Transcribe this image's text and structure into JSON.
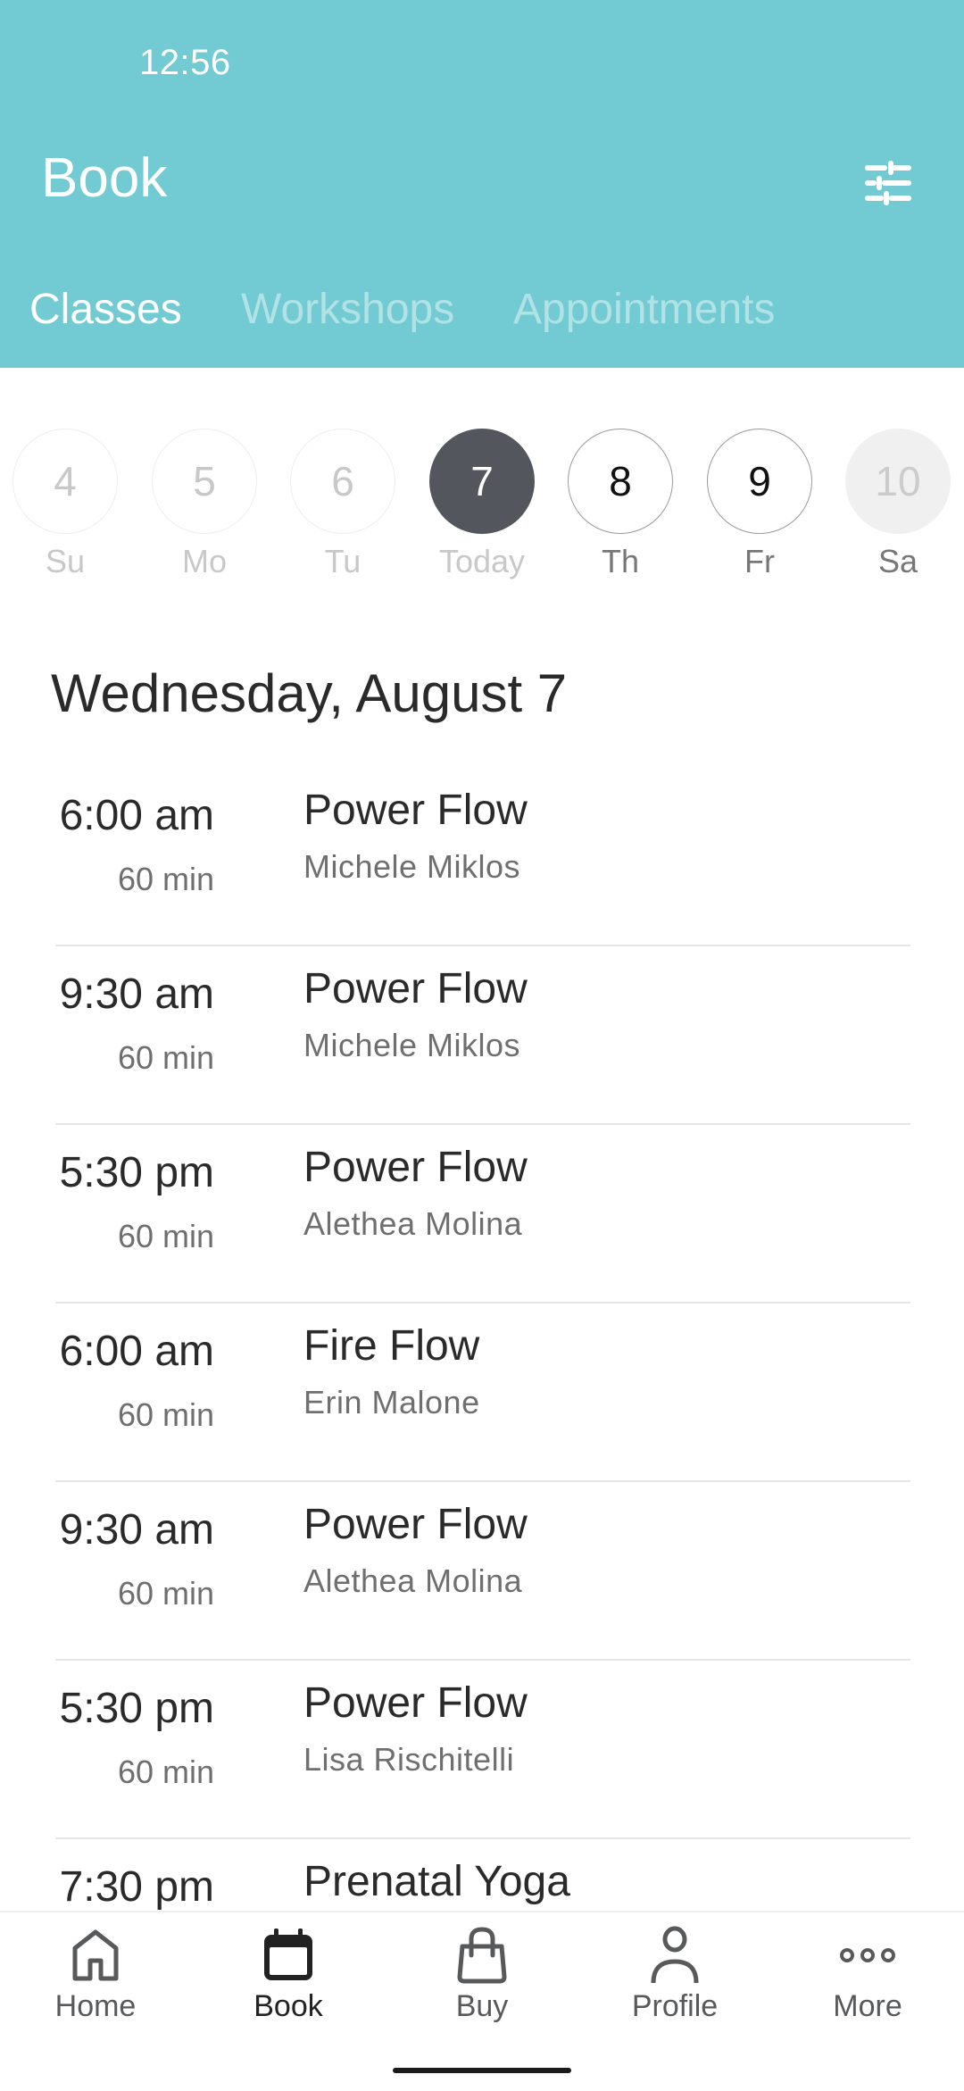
{
  "status_bar": {
    "time": "12:56"
  },
  "header": {
    "title": "Book",
    "filter_icon": "sliders-icon",
    "accent_color": "#72CBD2"
  },
  "tabs": [
    {
      "label": "Classes",
      "active": true
    },
    {
      "label": "Workshops",
      "active": false
    },
    {
      "label": "Appointments",
      "active": false
    }
  ],
  "days": [
    {
      "number": "4",
      "label": "Su",
      "state": "past"
    },
    {
      "number": "5",
      "label": "Mo",
      "state": "past"
    },
    {
      "number": "6",
      "label": "Tu",
      "state": "past"
    },
    {
      "number": "7",
      "label": "Today",
      "state": "selected"
    },
    {
      "number": "8",
      "label": "Th",
      "state": "future"
    },
    {
      "number": "9",
      "label": "Fr",
      "state": "future"
    },
    {
      "number": "10",
      "label": "Sa",
      "state": "disabled"
    }
  ],
  "date_heading": "Wednesday, August 7",
  "classes": [
    {
      "time": "6:00 am",
      "duration": "60 min",
      "name": "Power Flow",
      "instructor": "Michele Miklos"
    },
    {
      "time": "9:30 am",
      "duration": "60 min",
      "name": "Power Flow",
      "instructor": "Michele Miklos"
    },
    {
      "time": "5:30 pm",
      "duration": "60 min",
      "name": "Power Flow",
      "instructor": "Alethea Molina"
    },
    {
      "time": "6:00 am",
      "duration": "60 min",
      "name": "Fire Flow",
      "instructor": "Erin Malone"
    },
    {
      "time": "9:30 am",
      "duration": "60 min",
      "name": "Power Flow",
      "instructor": "Alethea Molina"
    },
    {
      "time": "5:30 pm",
      "duration": "60 min",
      "name": "Power Flow",
      "instructor": "Lisa Rischitelli"
    },
    {
      "time": "7:30 pm",
      "duration": "",
      "name": "Prenatal Yoga",
      "instructor": ""
    }
  ],
  "bottom_nav": [
    {
      "label": "Home",
      "icon": "home-icon",
      "active": false
    },
    {
      "label": "Book",
      "icon": "calendar-icon",
      "active": true
    },
    {
      "label": "Buy",
      "icon": "shopping-bag-icon",
      "active": false
    },
    {
      "label": "Profile",
      "icon": "person-icon",
      "active": false
    },
    {
      "label": "More",
      "icon": "more-dots-icon",
      "active": false
    }
  ]
}
